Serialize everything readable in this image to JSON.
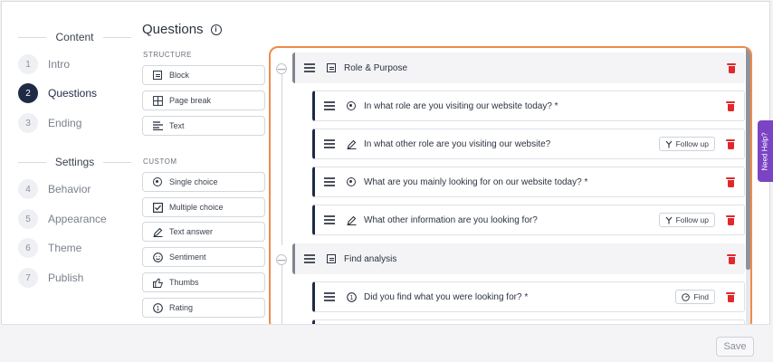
{
  "nav": {
    "content_heading": "Content",
    "settings_heading": "Settings",
    "content_steps": [
      {
        "num": "1",
        "label": "Intro"
      },
      {
        "num": "2",
        "label": "Questions"
      },
      {
        "num": "3",
        "label": "Ending"
      }
    ],
    "settings_steps": [
      {
        "num": "4",
        "label": "Behavior"
      },
      {
        "num": "5",
        "label": "Appearance"
      },
      {
        "num": "6",
        "label": "Theme"
      },
      {
        "num": "7",
        "label": "Publish"
      }
    ]
  },
  "page": {
    "title": "Questions",
    "info_icon": "i"
  },
  "palette": {
    "structure_heading": "STRUCTURE",
    "custom_heading": "CUSTOM",
    "structure": [
      {
        "label": "Block",
        "icon": "block-icon"
      },
      {
        "label": "Page break",
        "icon": "page-break-icon"
      },
      {
        "label": "Text",
        "icon": "text-icon"
      }
    ],
    "custom": [
      {
        "label": "Single choice",
        "icon": "single-choice-icon"
      },
      {
        "label": "Multiple choice",
        "icon": "checkbox-icon"
      },
      {
        "label": "Text answer",
        "icon": "pencil-icon"
      },
      {
        "label": "Sentiment",
        "icon": "smiley-icon"
      },
      {
        "label": "Thumbs",
        "icon": "thumbs-up-icon"
      },
      {
        "label": "Rating",
        "icon": "rating-icon"
      }
    ]
  },
  "builder": {
    "blocks": [
      {
        "title": "Role & Purpose",
        "questions": [
          {
            "text": "In what role are you visiting our website today? *",
            "type": "single-choice",
            "tag": ""
          },
          {
            "text": "In what other role are you visiting our website?",
            "type": "text-answer",
            "tag": "Follow up"
          },
          {
            "text": "What are you mainly looking for on our website today? *",
            "type": "single-choice",
            "tag": ""
          },
          {
            "text": "What other information are you looking for?",
            "type": "text-answer",
            "tag": "Follow up"
          }
        ]
      },
      {
        "title": "Find analysis",
        "questions": [
          {
            "text": "Did you find what you were looking for? *",
            "type": "rating",
            "tag": "Find"
          }
        ]
      }
    ],
    "collapse_symbol": "—"
  },
  "footer": {
    "save_label": "Save"
  },
  "help_tab": {
    "label": "Need Help?"
  },
  "colors": {
    "accent": "#1f2a44",
    "highlight_border": "#f08a4b",
    "delete": "#e0282e",
    "help": "#7b44c4"
  }
}
